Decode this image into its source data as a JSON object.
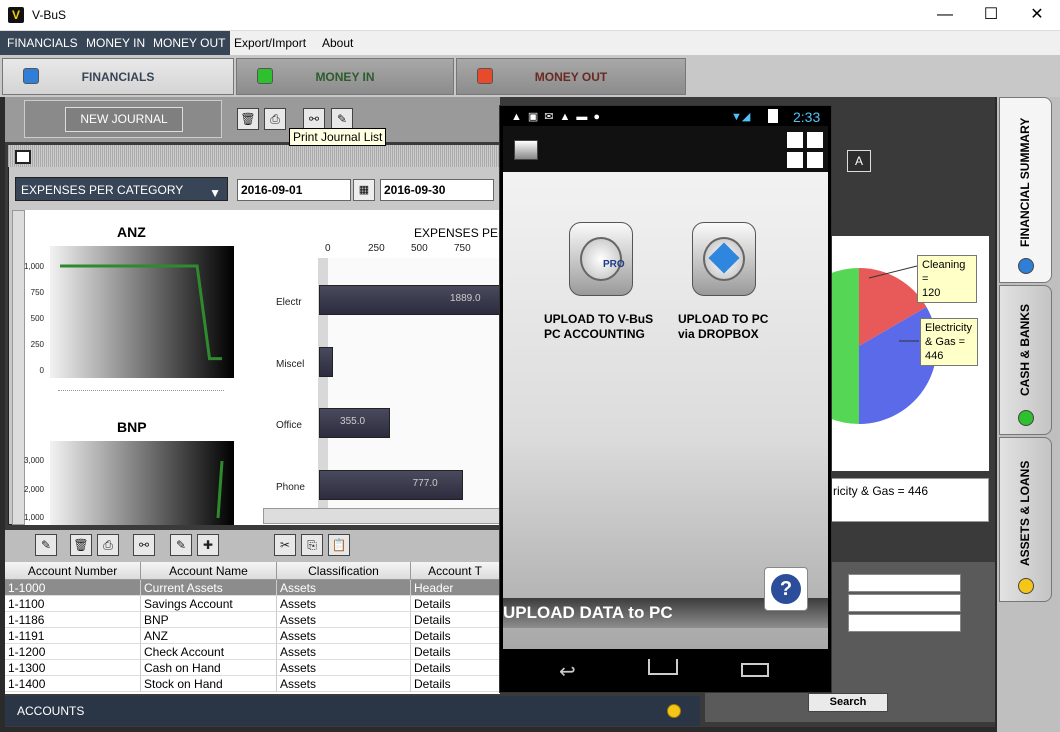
{
  "window": {
    "title": "V-BuS",
    "logo_letter": "V",
    "minimize": "—",
    "maximize": "☐",
    "close": "✕"
  },
  "menu": {
    "items": [
      "FINANCIALS",
      "MONEY IN",
      "MONEY OUT",
      "Export/Import",
      "About"
    ]
  },
  "tabs": [
    {
      "label": "FINANCIALS",
      "color": "#2f7fd8"
    },
    {
      "label": "MONEY IN",
      "color": "#2ec02e"
    },
    {
      "label": "MONEY OUT",
      "color": "#e84b2b"
    }
  ],
  "toolbar": {
    "new_journal": "NEW JOURNAL",
    "tooltip": "Print Journal List"
  },
  "report": {
    "selected": "EXPENSES PER CATEGORY",
    "date_from": "2016-09-01",
    "date_to": "2016-09-30",
    "chart_title_partial": "EXPENSES PER",
    "right_icon_letter": "A"
  },
  "chart_data": [
    {
      "type": "line",
      "title": "ANZ",
      "yticks": [
        "1,000",
        "750",
        "500",
        "250",
        "0"
      ],
      "values": [
        1000,
        1000,
        1000,
        1000,
        1000,
        1000,
        1000,
        1000,
        1000,
        1000,
        1000,
        1000,
        110,
        110
      ],
      "ylim": [
        0,
        1100
      ]
    },
    {
      "type": "line",
      "title": "BNP",
      "yticks": [
        "3,000",
        "2,000",
        "1,000"
      ],
      "values": [
        1000,
        3000
      ],
      "ylim": [
        900,
        3200
      ]
    },
    {
      "type": "bar",
      "orientation": "horizontal",
      "categories": [
        "Electr",
        "Miscel",
        "Office",
        "Phone"
      ],
      "values": [
        1889.0,
        25,
        355.0,
        777.0
      ],
      "value_labels": [
        "1889.0",
        "",
        "355.0",
        "777.0"
      ],
      "xticks": [
        "0",
        "250",
        "500",
        "750"
      ],
      "xlim": [
        0,
        1000
      ]
    },
    {
      "type": "pie",
      "labels": [
        "Cleaning",
        "Electricity & Gas"
      ],
      "values": [
        120,
        446
      ],
      "callouts": [
        "Cleaning =\n120",
        "Electricity\n& Gas =\n446"
      ],
      "legend_text": "ricity & Gas = 446"
    }
  ],
  "sidebar": [
    {
      "label": "FINANCIAL SUMMARY",
      "color": "#2f7fd8"
    },
    {
      "label": "CASH & BANKS",
      "color": "#2ec02e"
    },
    {
      "label": "ASSETS & LOANS",
      "color": "#f5c518"
    }
  ],
  "accounts": {
    "columns": [
      "Account Number",
      "Account Name",
      "Classification",
      "Account T"
    ],
    "rows": [
      [
        "1-1000",
        "Current Assets",
        "Assets",
        "Header"
      ],
      [
        "1-1100",
        "Savings Account",
        "Assets",
        "Details"
      ],
      [
        "1-1186",
        "BNP",
        "Assets",
        "Details"
      ],
      [
        "1-1191",
        "ANZ",
        "Assets",
        "Details"
      ],
      [
        "1-1200",
        "Check Account",
        "Assets",
        "Details"
      ],
      [
        "1-1300",
        "Cash on Hand",
        "Assets",
        "Details"
      ],
      [
        "1-1400",
        "Stock on Hand",
        "Assets",
        "Details"
      ]
    ],
    "footer": "ACCOUNTS"
  },
  "search": {
    "button": "Search"
  },
  "phone": {
    "time": "2:33",
    "upload_pc_label": "UPLOAD TO V-BuS\nPC ACCOUNTING",
    "upload_dropbox_label": "UPLOAD TO PC\nvia DROPBOX",
    "upload_title": "UPLOAD DATA to PC",
    "pro_badge": "PRO",
    "help_icon": "?"
  }
}
